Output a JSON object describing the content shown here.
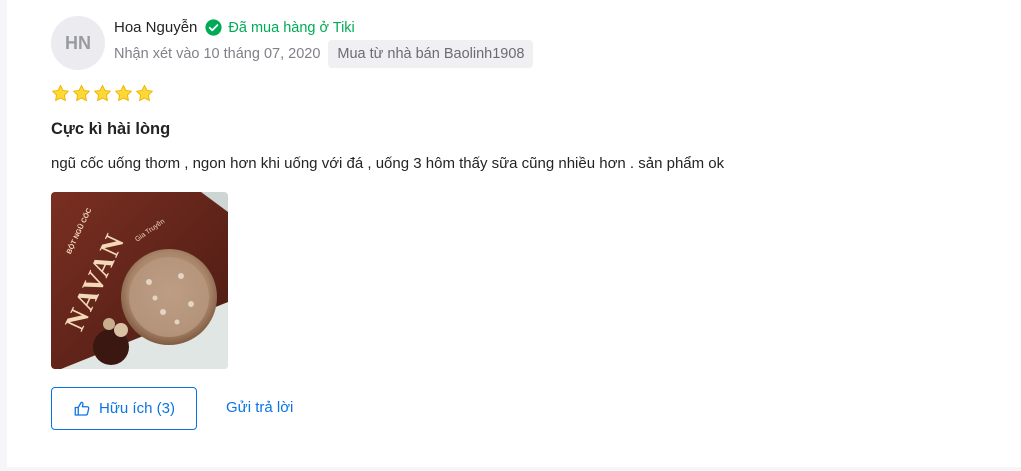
{
  "review": {
    "avatar_initials": "HN",
    "reviewer_name": "Hoa Nguyễn",
    "verified_label": "Đã mua hàng ở Tiki",
    "review_date": "Nhận xét vào 10 tháng 07, 2020",
    "seller_badge": "Mua từ nhà bán Baolinh1908",
    "rating": 5,
    "title": "Cực kì hài lòng",
    "content": "ngũ cốc uống thơm , ngon hơn khi uống với đá , uống 3 hôm thấy sữa cũng nhiều hơn . sản phẩm ok",
    "photo": {
      "product_brand": "NAVAN",
      "product_line": "BỘT NGŨ CỐC",
      "product_sub": "Gia Truyền"
    }
  },
  "actions": {
    "helpful_label": "Hữu ích (3)",
    "reply_label": "Gửi trả lời"
  },
  "colors": {
    "verified_green": "#00ab56",
    "accent_blue": "#0b74e5",
    "star_gold": "#fdd836"
  }
}
